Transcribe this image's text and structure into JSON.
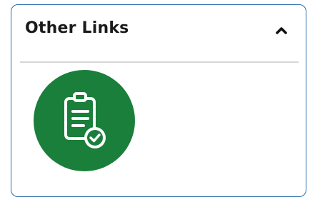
{
  "panel": {
    "title": "Other Links",
    "toggle_icon": "chevron-up-icon",
    "colors": {
      "border": "#2b6cb0",
      "title": "#1a1a1a",
      "divider": "#d6d6d6"
    }
  },
  "links": [
    {
      "icon": "clipboard-check-icon",
      "color": "#1a7f3a"
    }
  ]
}
